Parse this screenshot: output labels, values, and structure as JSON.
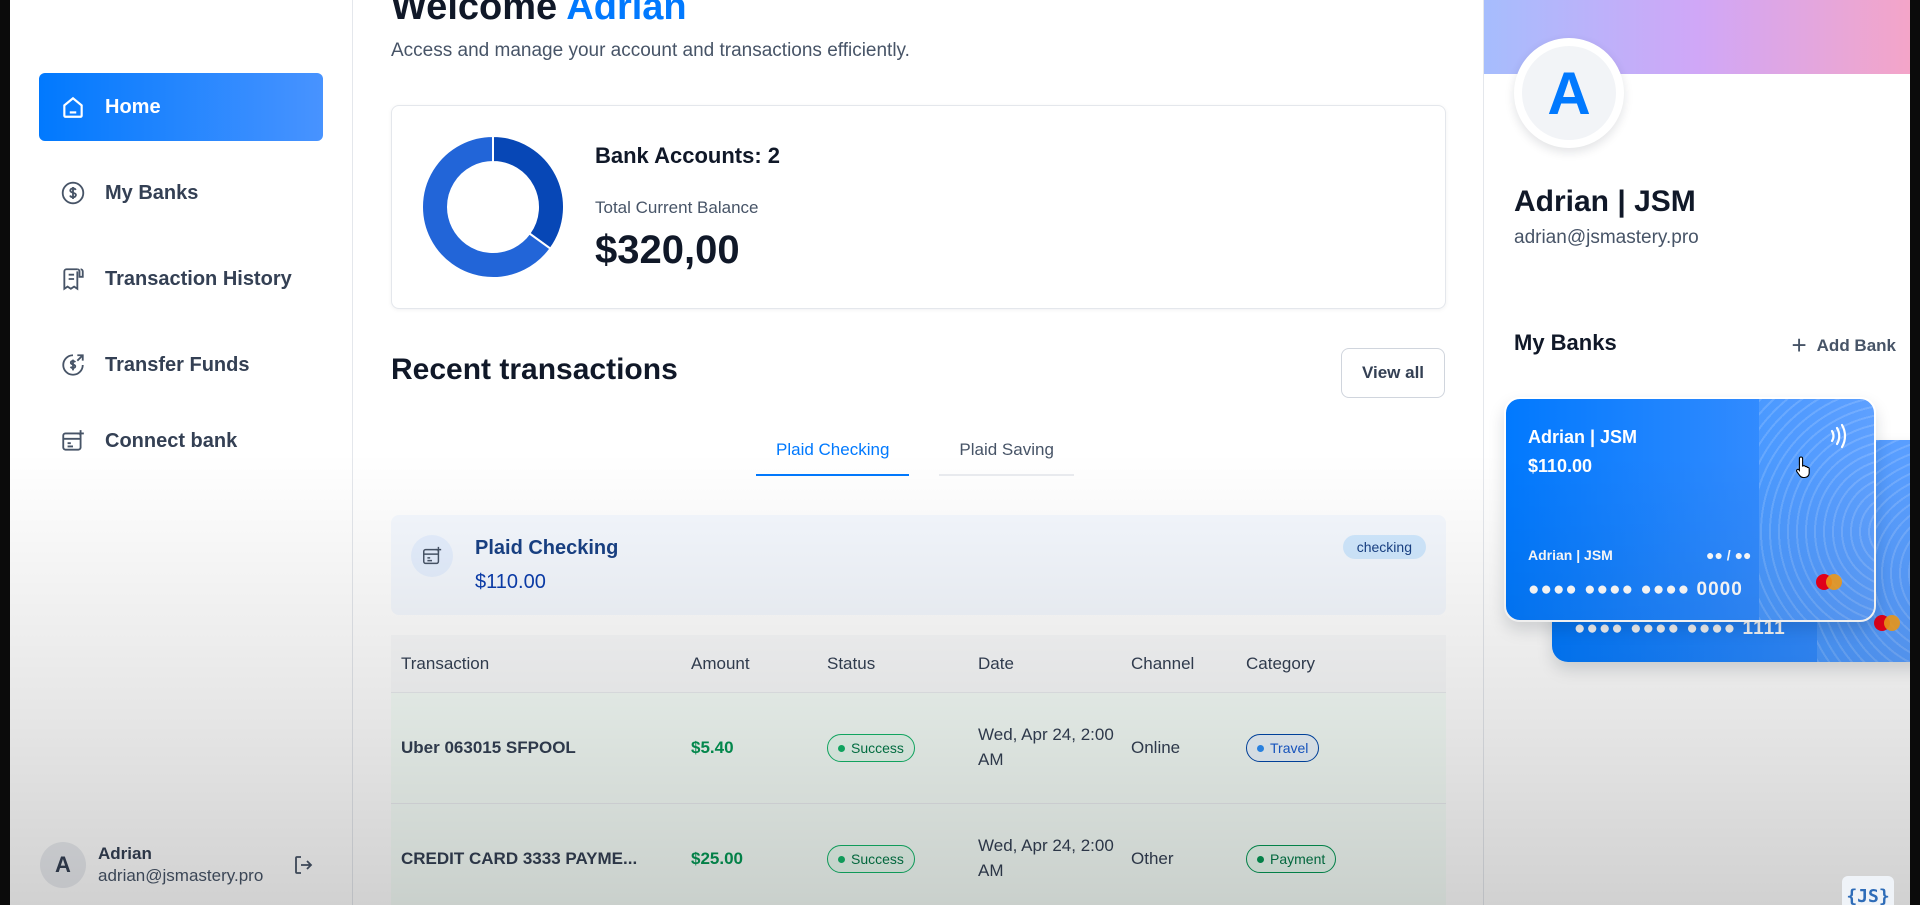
{
  "sidebar": {
    "nav": [
      {
        "label": "Home",
        "icon": "home-icon",
        "active": true
      },
      {
        "label": "My Banks",
        "icon": "dollar-circle-icon"
      },
      {
        "label": "Transaction History",
        "icon": "receipt-icon"
      },
      {
        "label": "Transfer Funds",
        "icon": "money-send-icon"
      },
      {
        "label": "Connect bank",
        "icon": "connect-bank-icon"
      }
    ],
    "user": {
      "initial": "A",
      "name": "Adrian",
      "email": "adrian@jsmastery.pro"
    }
  },
  "header": {
    "welcome_prefix": "Welcome",
    "welcome_name": "Adrian",
    "subtitle": "Access and manage your account and transactions efficiently."
  },
  "balance": {
    "accounts_label": "Bank Accounts: 2",
    "total_label": "Total Current Balance",
    "total_value": "$320,00",
    "donut_share": [
      0.35,
      0.65
    ],
    "colors": [
      "#0747b6",
      "#2265d8"
    ]
  },
  "recent": {
    "title": "Recent transactions",
    "view_all": "View all",
    "tabs": [
      "Plaid Checking",
      "Plaid Saving"
    ],
    "bank": {
      "name": "Plaid Checking",
      "amount": "$110.00",
      "type": "checking"
    },
    "columns": [
      "Transaction",
      "Amount",
      "Status",
      "Date",
      "Channel",
      "Category"
    ],
    "rows": [
      {
        "name": "Uber 063015 SFPOOL",
        "amount": "$5.40",
        "status": "Success",
        "date": "Wed, Apr 24, 2:00 AM",
        "channel": "Online",
        "category": "Travel"
      },
      {
        "name": "CREDIT CARD 3333 PAYME...",
        "amount": "$25.00",
        "status": "Success",
        "date": "Wed, Apr 24, 2:00 AM",
        "channel": "Other",
        "category": "Payment"
      }
    ]
  },
  "profile": {
    "initial": "A",
    "name": "Adrian | JSM",
    "email": "adrian@jsmastery.pro"
  },
  "banks": {
    "title": "My Banks",
    "add_label": "Add Bank",
    "cards": [
      {
        "name": "Adrian | JSM",
        "amount": "$110.00",
        "holder": "Adrian | JSM",
        "expiry": "●● / ●●",
        "number": "●●●● ●●●● ●●●● 0000"
      },
      {
        "number": "●●●● ●●●● ●●●● 1111"
      }
    ]
  },
  "watermark": "{JS}"
}
